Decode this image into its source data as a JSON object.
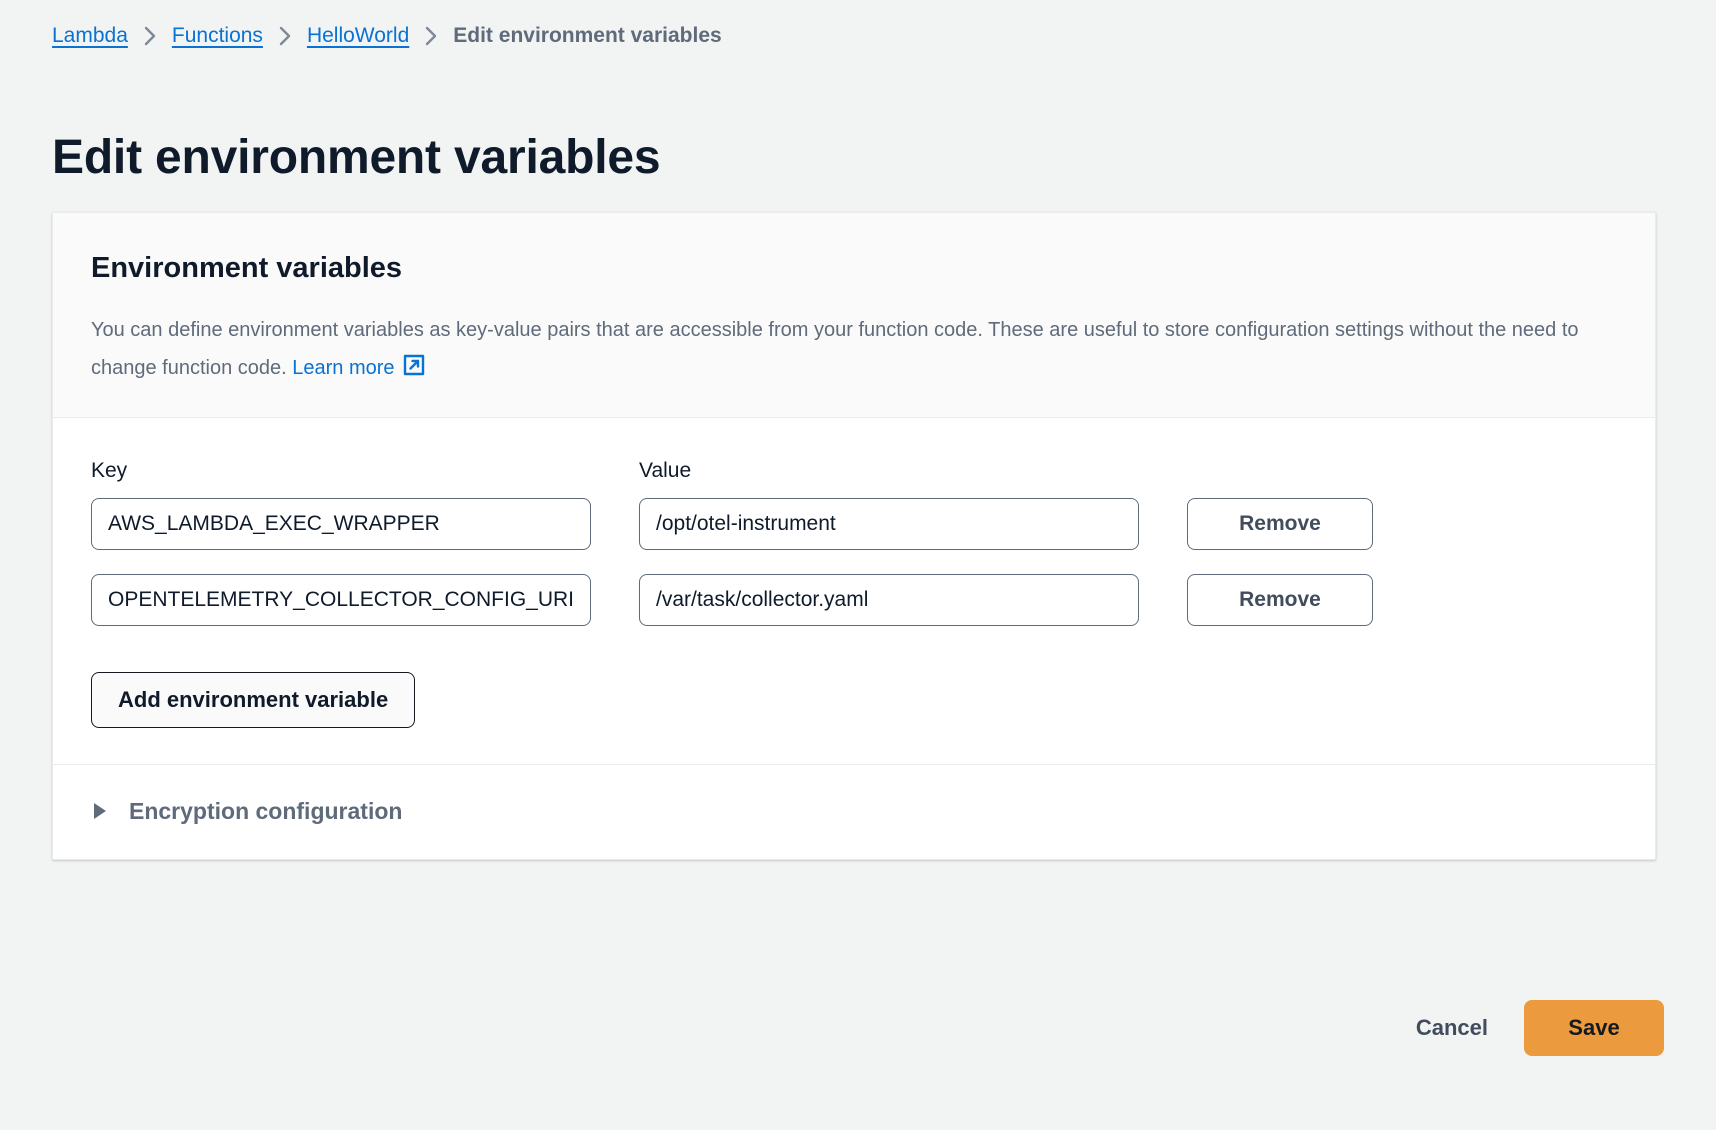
{
  "breadcrumb": {
    "items": [
      {
        "label": "Lambda",
        "type": "link"
      },
      {
        "label": "Functions",
        "type": "link"
      },
      {
        "label": "HelloWorld",
        "type": "link"
      },
      {
        "label": "Edit environment variables",
        "type": "current"
      }
    ],
    "separator_icon": "chevron-right-icon"
  },
  "page": {
    "title": "Edit environment variables"
  },
  "card": {
    "heading": "Environment variables",
    "description_part1": "You can define environment variables as key-value pairs that are accessible from your function code. These are useful to store configuration settings without the need to change function code. ",
    "learn_more_label": "Learn more",
    "learn_more_icon": "external-link-icon",
    "columns": {
      "key_label": "Key",
      "value_label": "Value"
    },
    "rows": [
      {
        "key": "AWS_LAMBDA_EXEC_WRAPPER",
        "value": "/opt/otel-instrument",
        "remove_label": "Remove"
      },
      {
        "key": "OPENTELEMETRY_COLLECTOR_CONFIG_URI",
        "value": "/var/task/collector.yaml",
        "remove_label": "Remove"
      }
    ],
    "add_button_label": "Add environment variable",
    "expander": {
      "label": "Encryption configuration",
      "caret_icon": "caret-right-icon",
      "expanded": false
    }
  },
  "footer": {
    "cancel_label": "Cancel",
    "save_label": "Save"
  },
  "colors": {
    "page_background": "#f2f3f3",
    "link": "#0972d3",
    "save_button": "#ec9a3e",
    "text_primary": "#0f1b2a",
    "text_secondary": "#5f6b7a",
    "input_border": "#5f6b7a"
  }
}
